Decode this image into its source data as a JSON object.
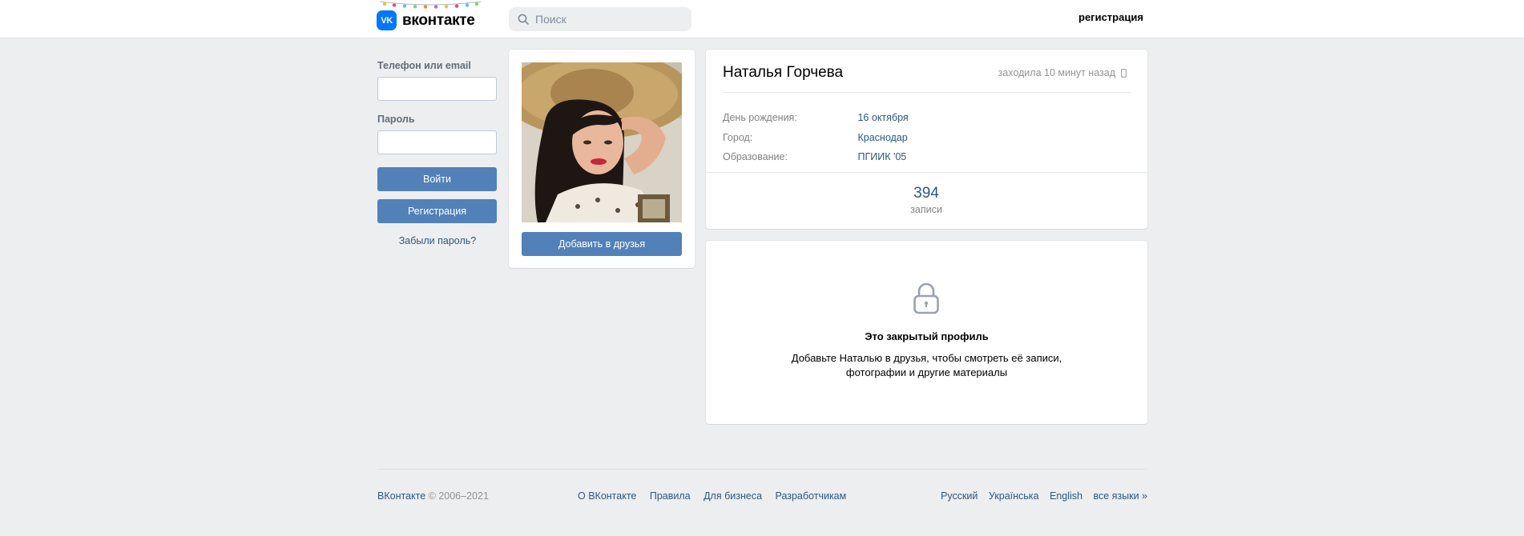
{
  "header": {
    "logo_mark": "VK",
    "logo_text": "вконтакте",
    "search_placeholder": "Поиск",
    "register_link": "регистрация"
  },
  "login": {
    "phone_label": "Телефон или email",
    "password_label": "Пароль",
    "login_button": "Войти",
    "register_button": "Регистрация",
    "forgot_link": "Забыли пароль?"
  },
  "profile": {
    "add_friend_button": "Добавить в друзья",
    "name": "Наталья Горчева",
    "last_seen": "заходила 10 минут назад",
    "details": [
      {
        "label": "День рождения:",
        "value": "16 октября"
      },
      {
        "label": "Город:",
        "value": "Краснодар"
      },
      {
        "label": "Образование:",
        "value": "ПГИИК '05"
      }
    ],
    "posts_count": "394",
    "posts_label": "записи"
  },
  "closed": {
    "title": "Это закрытый профиль",
    "text": "Добавьте Наталью в друзья, чтобы смотреть её записи, фотографии и другие материалы"
  },
  "footer": {
    "brand": "ВКонтакте",
    "copyright": "© 2006–2021",
    "links": [
      "О ВКонтакте",
      "Правила",
      "Для бизнеса",
      "Разработчикам"
    ],
    "languages": [
      "Русский",
      "Українська",
      "English",
      "все языки »"
    ]
  },
  "colors": {
    "accent": "#5181b8",
    "link": "#2a5885",
    "background": "#edeef0",
    "logo": "#0077ff"
  }
}
